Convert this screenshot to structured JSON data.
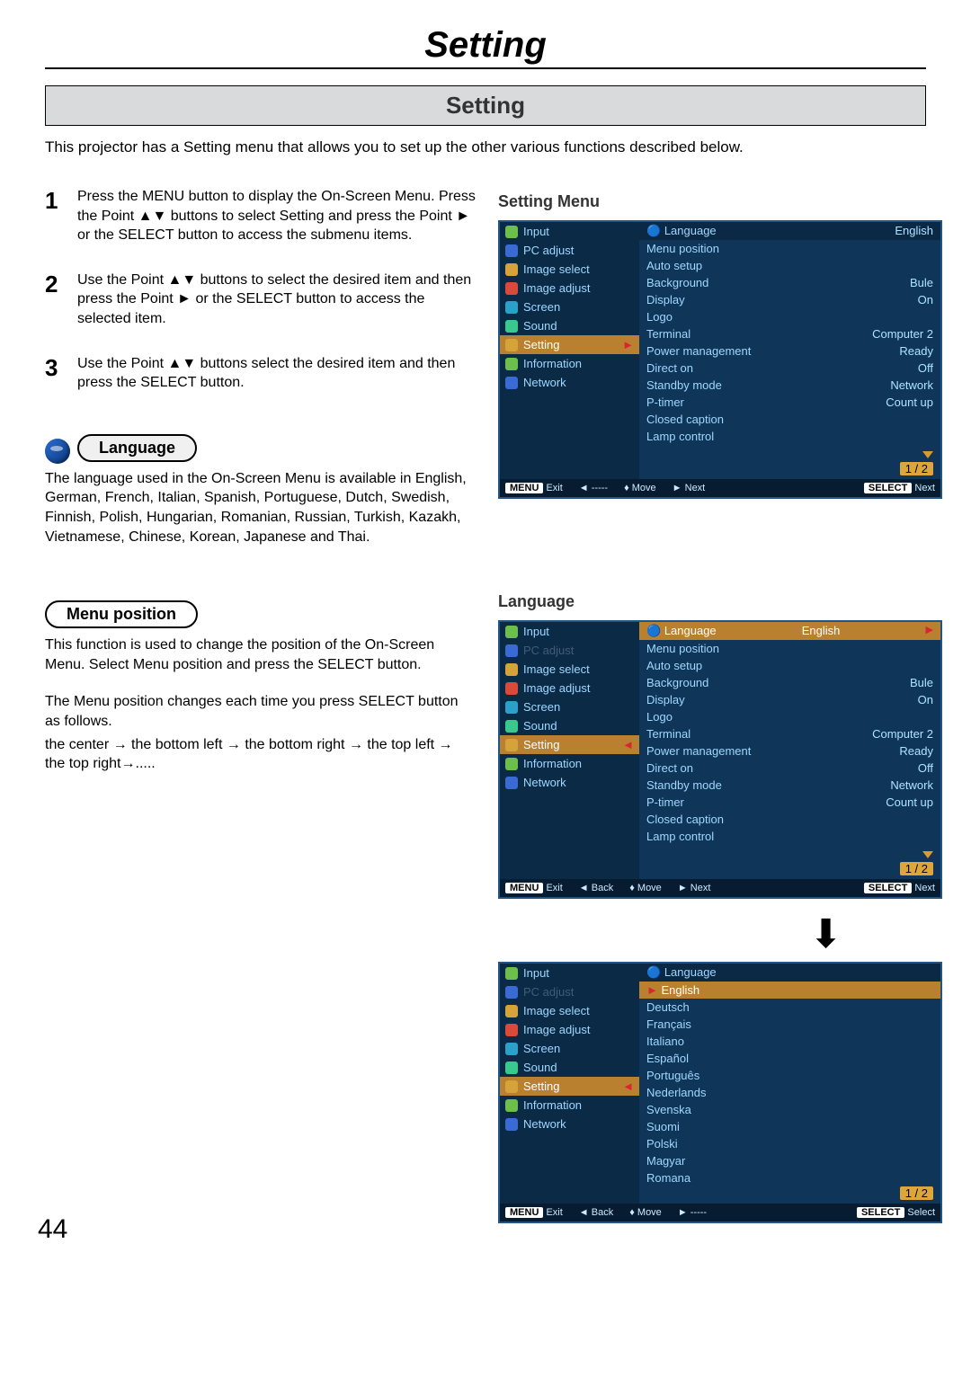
{
  "page": {
    "number": "44",
    "title": "Setting",
    "section": "Setting"
  },
  "intro": "This projector has a Setting menu that allows you to set up the other various functions described below.",
  "steps": [
    {
      "num": "1",
      "text": "Press the MENU button to display the On-Screen Menu. Press the Point ▲▼ buttons to select Setting and press the Point ► or the SELECT button to access the submenu items."
    },
    {
      "num": "2",
      "text": "Use the Point ▲▼ buttons to select the desired item and then press the Point ► or the SELECT button to access the selected item."
    },
    {
      "num": "3",
      "text": "Use the Point ▲▼ buttons select the desired item and then press the SELECT button."
    }
  ],
  "left": {
    "lang_pill": "Language",
    "lang_text": "The language used in the On-Screen Menu is available in English, German, French, Italian, Spanish, Portuguese, Dutch, Swedish, Finnish, Polish, Hungarian, Romanian, Russian, Turkish, Kazakh, Vietnamese, Chinese, Korean, Japanese and Thai.",
    "menupos_pill": "Menu position",
    "menupos_text1": "This function is used to change the position of the On-Screen Menu. Select Menu position and press the SELECT button.",
    "menupos_text2": "The Menu position changes each time you press SELECT button as follows.",
    "menupos_text3": "the center → the bottom left → the bottom right → the top left → the top right→....."
  },
  "right": {
    "h1": "Setting Menu",
    "h2": "Language"
  },
  "sidebar_items": [
    "Input",
    "PC adjust",
    "Image select",
    "Image adjust",
    "Screen",
    "Sound",
    "Setting",
    "Information",
    "Network"
  ],
  "osd1": {
    "header": "Language",
    "items": [
      {
        "l": "Language",
        "v": "English"
      },
      {
        "l": "Menu position",
        "v": ""
      },
      {
        "l": "Auto setup",
        "v": ""
      },
      {
        "l": "Background",
        "v": "Bule"
      },
      {
        "l": "Display",
        "v": "On"
      },
      {
        "l": "Logo",
        "v": ""
      },
      {
        "l": "Terminal",
        "v": "Computer 2"
      },
      {
        "l": "Power management",
        "v": "Ready"
      },
      {
        "l": "Direct on",
        "v": "Off"
      },
      {
        "l": "Standby mode",
        "v": "Network"
      },
      {
        "l": "P-timer",
        "v": "Count up"
      },
      {
        "l": "Closed caption",
        "v": ""
      },
      {
        "l": "Lamp control",
        "v": ""
      }
    ],
    "page": "1 / 2",
    "footer": {
      "a": "Exit",
      "b": "-----",
      "c": "Move",
      "d": "Next",
      "e": "Next"
    }
  },
  "osd2": {
    "header": "Language",
    "sel_val": "English",
    "items": [
      {
        "l": "Language",
        "v": "English",
        "sel": true
      },
      {
        "l": "Menu position",
        "v": ""
      },
      {
        "l": "Auto setup",
        "v": ""
      },
      {
        "l": "Background",
        "v": "Bule"
      },
      {
        "l": "Display",
        "v": "On"
      },
      {
        "l": "Logo",
        "v": ""
      },
      {
        "l": "Terminal",
        "v": "Computer 2"
      },
      {
        "l": "Power management",
        "v": "Ready"
      },
      {
        "l": "Direct on",
        "v": "Off"
      },
      {
        "l": "Standby mode",
        "v": "Network"
      },
      {
        "l": "P-timer",
        "v": "Count up"
      },
      {
        "l": "Closed caption",
        "v": ""
      },
      {
        "l": "Lamp control",
        "v": ""
      }
    ],
    "page": "1 / 2",
    "footer": {
      "a": "Exit",
      "b": "Back",
      "c": "Move",
      "d": "Next",
      "e": "Next"
    }
  },
  "osd3": {
    "header": "Language",
    "langs": [
      "English",
      "Deutsch",
      "Français",
      "Italiano",
      "Español",
      "Português",
      "Nederlands",
      "Svenska",
      "Suomi",
      "Polski",
      "Magyar",
      "Romana"
    ],
    "page": "1 / 2",
    "footer": {
      "a": "Exit",
      "b": "Back",
      "c": "Move",
      "d": "-----",
      "e": "Select"
    }
  },
  "icons": {
    "down": "▼",
    "up": "▲",
    "left": "◄",
    "right": "►",
    "menu": "MENU",
    "select": "SELECT",
    "move": "♦"
  }
}
